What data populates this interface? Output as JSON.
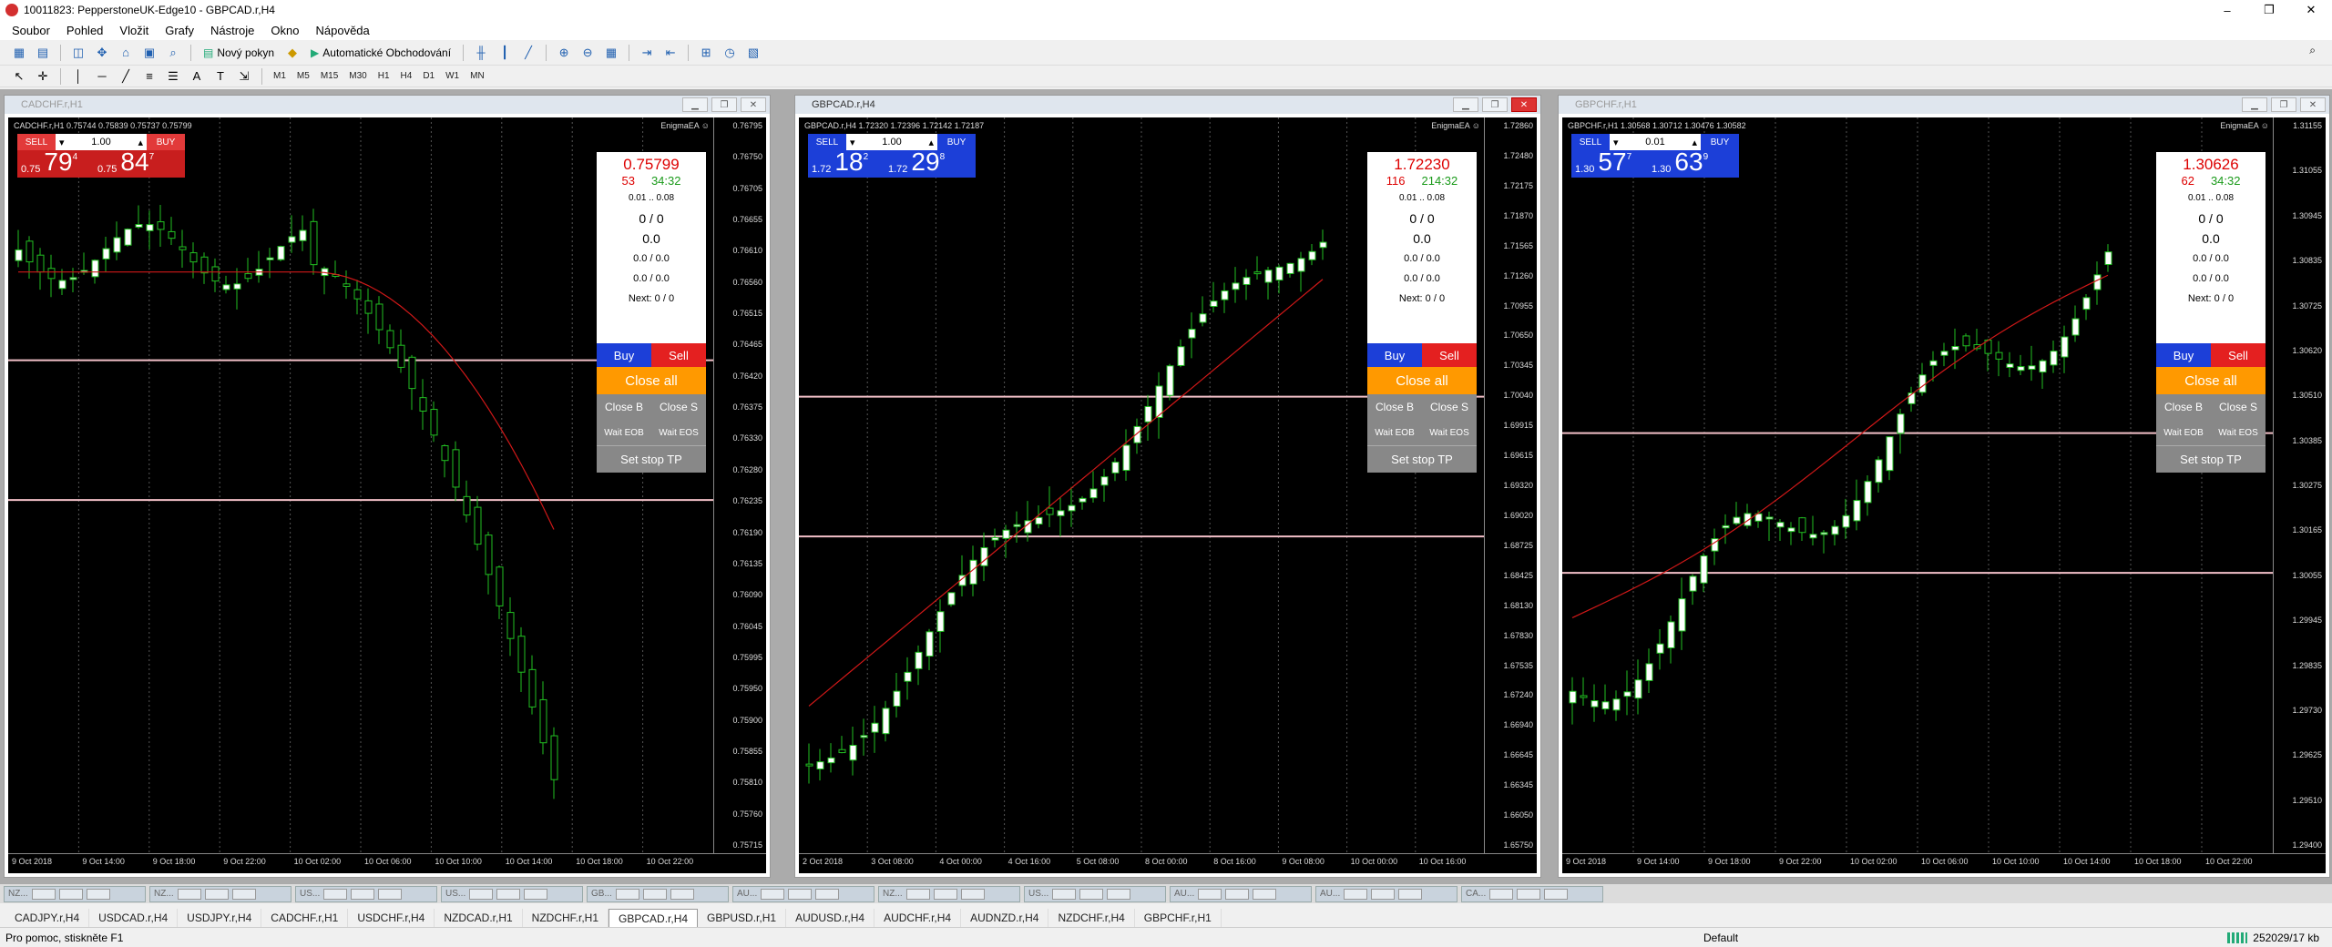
{
  "window": {
    "title": "10011823: PepperstoneUK-Edge10 - GBPCAD.r,H4",
    "controls": [
      "–",
      "❐",
      "✕"
    ]
  },
  "menu": [
    "Soubor",
    "Pohled",
    "Vložit",
    "Grafy",
    "Nástroje",
    "Okno",
    "Nápověda"
  ],
  "toolbar": {
    "new_order": "Nový pokyn",
    "auto_trading": "Automatické Obchodování",
    "timeframes": [
      "M1",
      "M5",
      "M15",
      "M30",
      "H1",
      "H4",
      "D1",
      "W1",
      "MN"
    ]
  },
  "charts": [
    {
      "caption": "CADCHF.r,H1",
      "ohlc": "CADCHF.r,H1  0.75744 0.75839 0.75737 0.75799",
      "ea": "EnigmaEA ☺",
      "lot": "1.00",
      "sell_label": "SELL",
      "buy_label": "BUY",
      "sell_small": "0.75",
      "sell_big": "79",
      "sell_sup": "4",
      "buy_small": "0.75",
      "buy_big": "84",
      "buy_sup": "7",
      "panel": {
        "bid": "0.75799",
        "left": "53",
        "right": "34:32",
        "range": "0.01 .. 0.08",
        "a": "0 / 0",
        "b": "0.0",
        "c": "0.0 / 0.0",
        "d": "0.0 / 0.0",
        "next": "Next: 0 / 0"
      },
      "price_labels": [
        "0.76795",
        "0.76750",
        "0.76705",
        "0.76655",
        "0.76610",
        "0.76560",
        "0.76515",
        "0.76465",
        "0.76420",
        "0.76375",
        "0.76330",
        "0.76280",
        "0.76235",
        "0.76190",
        "0.76135",
        "0.76090",
        "0.76045",
        "0.75995",
        "0.75950",
        "0.75900",
        "0.75855",
        "0.75810",
        "0.75760",
        "0.75715"
      ],
      "time_labels": [
        "9 Oct 2018",
        "9 Oct 14:00",
        "9 Oct 18:00",
        "9 Oct 22:00",
        "10 Oct 02:00",
        "10 Oct 06:00",
        "10 Oct 10:00",
        "10 Oct 14:00",
        "10 Oct 18:00",
        "10 Oct 22:00"
      ]
    },
    {
      "caption": "GBPCAD.r,H4",
      "ohlc": "GBPCAD.r,H4  1.72320 1.72396 1.72142 1.72187",
      "ea": "EnigmaEA ☺",
      "lot": "1.00",
      "sell_label": "SELL",
      "buy_label": "BUY",
      "sell_small": "1.72",
      "sell_big": "18",
      "sell_sup": "2",
      "buy_small": "1.72",
      "buy_big": "29",
      "buy_sup": "8",
      "panel": {
        "bid": "1.72230",
        "left": "116",
        "right": "214:32",
        "range": "0.01 .. 0.08",
        "a": "0 / 0",
        "b": "0.0",
        "c": "0.0 / 0.0",
        "d": "0.0 / 0.0",
        "next": "Next: 0 / 0"
      },
      "price_labels": [
        "1.72860",
        "1.72480",
        "1.72175",
        "1.71870",
        "1.71565",
        "1.71260",
        "1.70955",
        "1.70650",
        "1.70345",
        "1.70040",
        "1.69915",
        "1.69615",
        "1.69320",
        "1.69020",
        "1.68725",
        "1.68425",
        "1.68130",
        "1.67830",
        "1.67535",
        "1.67240",
        "1.66940",
        "1.66645",
        "1.66345",
        "1.66050",
        "1.65750"
      ],
      "time_labels": [
        "2 Oct 2018",
        "3 Oct 08:00",
        "4 Oct 00:00",
        "4 Oct 16:00",
        "5 Oct 08:00",
        "8 Oct 00:00",
        "8 Oct 16:00",
        "9 Oct 08:00",
        "10 Oct 00:00",
        "10 Oct 16:00"
      ]
    },
    {
      "caption": "GBPCHF.r,H1",
      "ohlc": "GBPCHF.r,H1  1.30568 1.30712 1.30476 1.30582",
      "ea": "EnigmaEA ☺",
      "lot": "0.01",
      "sell_label": "SELL",
      "buy_label": "BUY",
      "sell_small": "1.30",
      "sell_big": "57",
      "sell_sup": "7",
      "buy_small": "1.30",
      "buy_big": "63",
      "buy_sup": "9",
      "panel": {
        "bid": "1.30626",
        "left": "62",
        "right": "34:32",
        "range": "0.01 .. 0.08",
        "a": "0 / 0",
        "b": "0.0",
        "c": "0.0 / 0.0",
        "d": "0.0 / 0.0",
        "next": "Next: 0 / 0"
      },
      "price_labels": [
        "1.31155",
        "1.31055",
        "1.30945",
        "1.30835",
        "1.30725",
        "1.30620",
        "1.30510",
        "1.30385",
        "1.30275",
        "1.30165",
        "1.30055",
        "1.29945",
        "1.29835",
        "1.29730",
        "1.29625",
        "1.29510",
        "1.29400"
      ],
      "time_labels": [
        "9 Oct 2018",
        "9 Oct 14:00",
        "9 Oct 18:00",
        "9 Oct 22:00",
        "10 Oct 02:00",
        "10 Oct 06:00",
        "10 Oct 10:00",
        "10 Oct 14:00",
        "10 Oct 18:00",
        "10 Oct 22:00"
      ]
    }
  ],
  "panel_buttons": {
    "buy": "Buy",
    "sell": "Sell",
    "close_all": "Close all",
    "close_b": "Close B",
    "close_s": "Close S",
    "wait_eob": "Wait EOB",
    "wait_eos": "Wait EOS",
    "set_stop": "Set stop TP"
  },
  "window_tabs": [
    "NZ...",
    "NZ...",
    "US...",
    "US...",
    "GB...",
    "AU...",
    "NZ...",
    "US...",
    "AU...",
    "AU...",
    "CA..."
  ],
  "chart_tabs": [
    "CADJPY.r,H4",
    "USDCAD.r,H4",
    "USDJPY.r,H4",
    "CADCHF.r,H1",
    "USDCHF.r,H4",
    "NZDCAD.r,H1",
    "NZDCHF.r,H1",
    "GBPCAD.r,H4",
    "GBPUSD.r,H1",
    "AUDUSD.r,H4",
    "AUDCHF.r,H4",
    "AUDNZD.r,H4",
    "NZDCHF.r,H4",
    "GBPCHF.r,H1"
  ],
  "active_chart_tab": "GBPCAD.r,H4",
  "status": {
    "help": "Pro pomoc, stiskněte F1",
    "profile": "Default",
    "traffic": "252029/17 kb"
  },
  "colors": {
    "sell": "#e23a3a",
    "buy_blue": "#1c3fd8",
    "close_all": "#ff9900",
    "bull": "#ffffff",
    "bear": "#000000",
    "candle_outline": "#22c022",
    "ma": "#d01818"
  }
}
